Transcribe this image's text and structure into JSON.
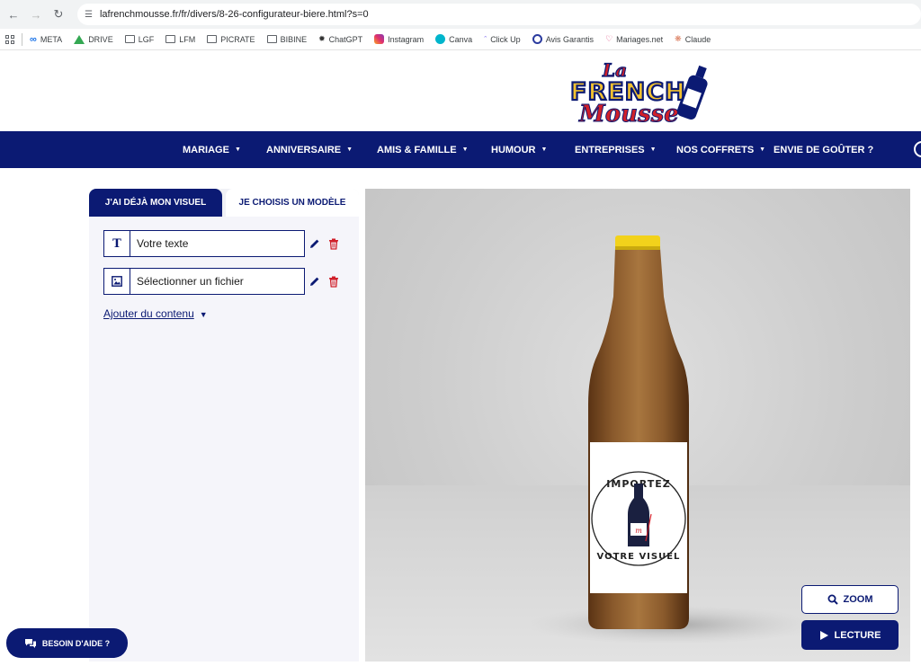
{
  "browser": {
    "url": "lafrenchmousse.fr/fr/divers/8-26-configurateur-biere.html?s=0",
    "bookmarks": [
      {
        "label": "META",
        "icon": "meta-icon"
      },
      {
        "label": "DRIVE",
        "icon": "drive-icon"
      },
      {
        "label": "LGF",
        "icon": "folder-icon"
      },
      {
        "label": "LFM",
        "icon": "folder-icon"
      },
      {
        "label": "PICRATE",
        "icon": "folder-icon"
      },
      {
        "label": "BIBINE",
        "icon": "folder-icon"
      },
      {
        "label": "ChatGPT",
        "icon": "chatgpt-icon"
      },
      {
        "label": "Instagram",
        "icon": "instagram-icon"
      },
      {
        "label": "Canva",
        "icon": "canva-icon"
      },
      {
        "label": "Click Up",
        "icon": "clickup-icon"
      },
      {
        "label": "Avis Garantis",
        "icon": "avis-icon"
      },
      {
        "label": "Mariages.net",
        "icon": "heart-icon"
      },
      {
        "label": "Claude",
        "icon": "claude-icon"
      }
    ]
  },
  "logo": {
    "line1": "La",
    "line2": "FRENCH",
    "line3": "Mousse"
  },
  "nav": {
    "items": [
      {
        "label": "MARIAGE",
        "dropdown": true
      },
      {
        "label": "ANNIVERSAIRE",
        "dropdown": true
      },
      {
        "label": "AMIS & FAMILLE",
        "dropdown": true
      },
      {
        "label": "HUMOUR",
        "dropdown": true
      },
      {
        "label": "ENTREPRISES",
        "dropdown": true
      },
      {
        "label": "NOS COFFRETS",
        "dropdown": true
      },
      {
        "label": "ENVIE DE GOÛTER ?",
        "dropdown": false
      }
    ]
  },
  "panel": {
    "tab_active": "J'AI DÉJÀ MON VISUEL",
    "tab_inactive": "JE CHOISIS UN MODÈLE",
    "row_text": "Votre texte",
    "row_file": "Sélectionner un fichier",
    "add_content": "Ajouter du contenu"
  },
  "label": {
    "top": "IMPORTEZ",
    "bottom": "VOTRE VISUEL"
  },
  "buttons": {
    "zoom": "ZOOM",
    "lecture": "LECTURE",
    "help": "BESOIN D'AIDE ?"
  },
  "colors": {
    "navy": "#0b1a73",
    "red": "#d0202a",
    "cap": "#f2d21b"
  }
}
